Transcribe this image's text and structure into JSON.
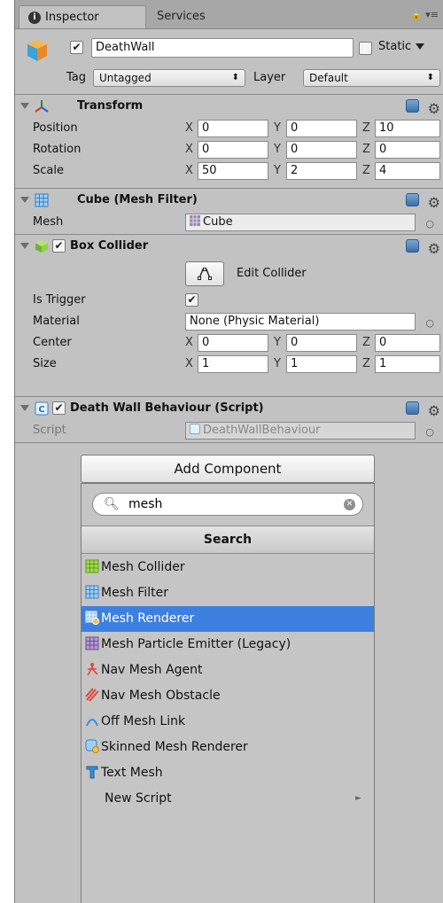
{
  "tabs": {
    "inspector": "Inspector",
    "services": "Services"
  },
  "gameobject": {
    "name": "DeathWall",
    "active": true,
    "static_label": "Static",
    "static": false
  },
  "tag": {
    "label": "Tag",
    "value": "Untagged"
  },
  "layer": {
    "label": "Layer",
    "value": "Default"
  },
  "transform": {
    "title": "Transform",
    "rows": [
      {
        "label": "Position",
        "x": "0",
        "y": "0",
        "z": "10"
      },
      {
        "label": "Rotation",
        "x": "0",
        "y": "0",
        "z": "0"
      },
      {
        "label": "Scale",
        "x": "50",
        "y": "2",
        "z": "4"
      }
    ]
  },
  "mesh_filter": {
    "title": "Cube (Mesh Filter)",
    "mesh_label": "Mesh",
    "mesh_value": "Cube"
  },
  "box_collider": {
    "title": "Box Collider",
    "enabled": true,
    "edit_label": "Edit Collider",
    "is_trigger_label": "Is Trigger",
    "is_trigger": true,
    "material_label": "Material",
    "material_value": "None (Physic Material)",
    "center_label": "Center",
    "center": {
      "x": "0",
      "y": "0",
      "z": "0"
    },
    "size_label": "Size",
    "size": {
      "x": "1",
      "y": "1",
      "z": "1"
    }
  },
  "script_comp": {
    "title": "Death Wall Behaviour (Script)",
    "enabled": true,
    "script_label": "Script",
    "script_value": "DeathWallBehaviour"
  },
  "axes": {
    "x": "X",
    "y": "Y",
    "z": "Z"
  },
  "add_component": {
    "button_label": "Add Component",
    "search_value": "mesh",
    "search_title": "Search",
    "items": [
      {
        "label": "Mesh Collider",
        "icon": "mesh-collider-icon"
      },
      {
        "label": "Mesh Filter",
        "icon": "mesh-filter-icon"
      },
      {
        "label": "Mesh Renderer",
        "icon": "mesh-renderer-icon",
        "selected": true
      },
      {
        "label": "Mesh Particle Emitter (Legacy)",
        "icon": "particle-emitter-icon"
      },
      {
        "label": "Nav Mesh Agent",
        "icon": "nav-agent-icon"
      },
      {
        "label": "Nav Mesh Obstacle",
        "icon": "nav-obstacle-icon"
      },
      {
        "label": "Off Mesh Link",
        "icon": "off-mesh-link-icon"
      },
      {
        "label": "Skinned Mesh Renderer",
        "icon": "skinned-renderer-icon"
      },
      {
        "label": "Text Mesh",
        "icon": "text-mesh-icon"
      },
      {
        "label": "New Script",
        "icon": "none"
      }
    ]
  },
  "colors": {
    "selection": "#3d80df",
    "panel": "#c2c2c2"
  }
}
